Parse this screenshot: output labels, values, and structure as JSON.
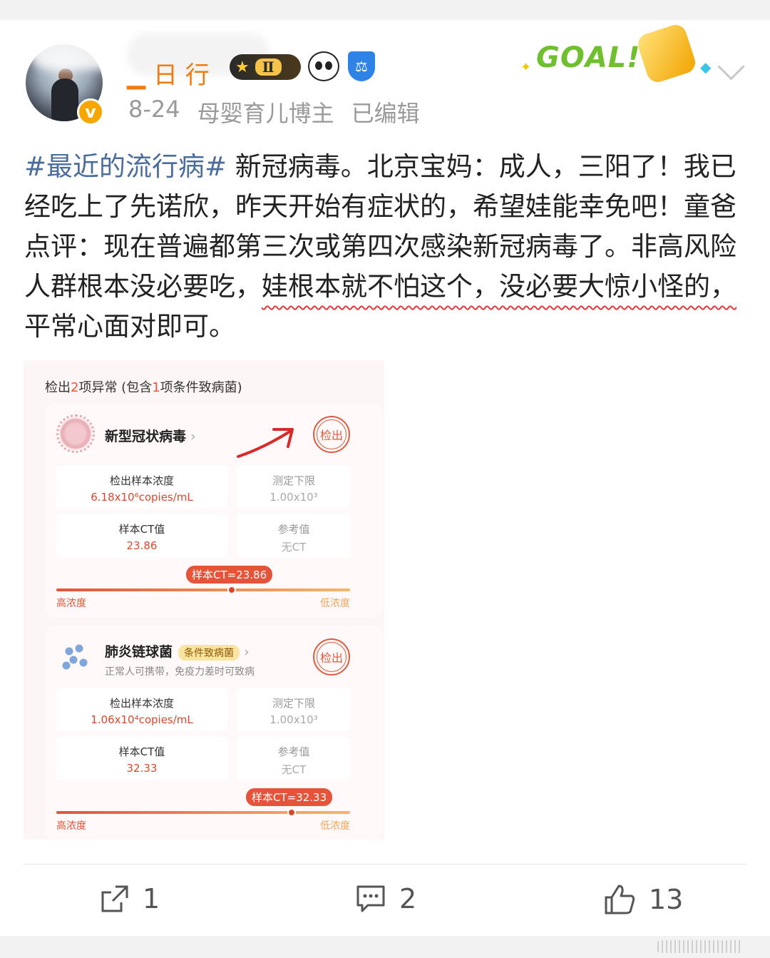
{
  "header": {
    "name_fragment": "▁ 日 行",
    "level_badge": "Ⅱ",
    "verified_mark": "v",
    "goal_text": "GOAL!",
    "date": "8-24",
    "user_title": "母婴育儿博主",
    "edited": "已编辑"
  },
  "post": {
    "hashtag": "#最近的流行病#",
    "text_a": " 新冠病毒。北京宝妈：成人，三阳了！我已经吃上了先诺欣，昨天开始有症状的，希望娃能幸免吧！童爸点评：现在普遍都第三次或第四次感染新冠病毒了。非高风险人群根本没必要吃，",
    "text_underlined": "娃根本就不怕这个，没必要大惊小怪的，",
    "text_b": "平常心面对即可。"
  },
  "report": {
    "summary_prefix": "检出",
    "summary_n1": "2",
    "summary_mid": "项异常 (包含",
    "summary_n2": "1",
    "summary_suffix": "项条件致病菌)",
    "pathogens": [
      {
        "name": "新型冠状病毒",
        "arrow": "›",
        "stamp": "检出",
        "conc_label": "检出样本浓度",
        "conc_value": "6.18x10⁶copies/mL",
        "limit_label": "测定下限",
        "limit_value": "1.00x10³",
        "ct_label": "样本CT值",
        "ct_value": "23.86",
        "ref_label": "参考值",
        "ref_value": "无CT",
        "ct_pill": "样本CT=23.86",
        "high": "高浓度",
        "low": "低浓度"
      },
      {
        "name": "肺炎链球菌",
        "tag": "条件致病菌",
        "arrow": "›",
        "desc": "正常人可携带，免疫力差时可致病",
        "stamp": "检出",
        "conc_label": "检出样本浓度",
        "conc_value": "1.06x10⁴copies/mL",
        "limit_label": "测定下限",
        "limit_value": "1.00x10³",
        "ct_label": "样本CT值",
        "ct_value": "32.33",
        "ref_label": "参考值",
        "ref_value": "无CT",
        "ct_pill": "样本CT=32.33",
        "high": "高浓度",
        "low": "低浓度"
      }
    ]
  },
  "actions": {
    "share_count": "1",
    "comment_count": "2",
    "like_count": "13"
  },
  "colors": {
    "hashtag": "#4a6d9c",
    "accent_red": "#e4533a",
    "verified": "#f7a600"
  }
}
